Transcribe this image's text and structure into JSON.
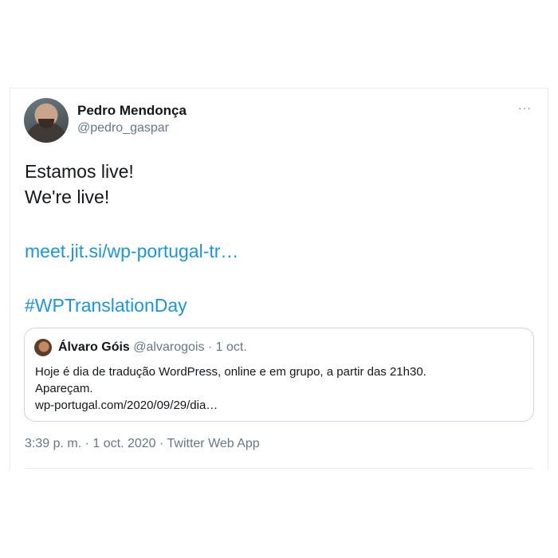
{
  "tweet": {
    "author_name": "Pedro Mendonça",
    "author_handle": "@pedro_gaspar",
    "more_icon": "···",
    "text_line1": "Estamos live!",
    "text_line2": "We're live!",
    "link": "meet.jit.si/wp-portugal-tr…",
    "hashtag": "#WPTranslationDay",
    "time": "3:39 p. m.",
    "date": "1 oct. 2020",
    "source": "Twitter Web App",
    "separator": "·"
  },
  "quoted_tweet": {
    "author_name": "Álvaro Góis",
    "author_handle": "@alvarogois",
    "date": "1 oct.",
    "separator": "·",
    "text_line1": "Hoje é dia de tradução WordPress, online e em grupo, a partir das 21h30.",
    "text_line2": "Apareçam.",
    "link": "wp-portugal.com/2020/09/29/dia…"
  },
  "colors": {
    "link": "#1b95e0",
    "secondary_text": "#657786",
    "border": "#ccd6dd"
  }
}
